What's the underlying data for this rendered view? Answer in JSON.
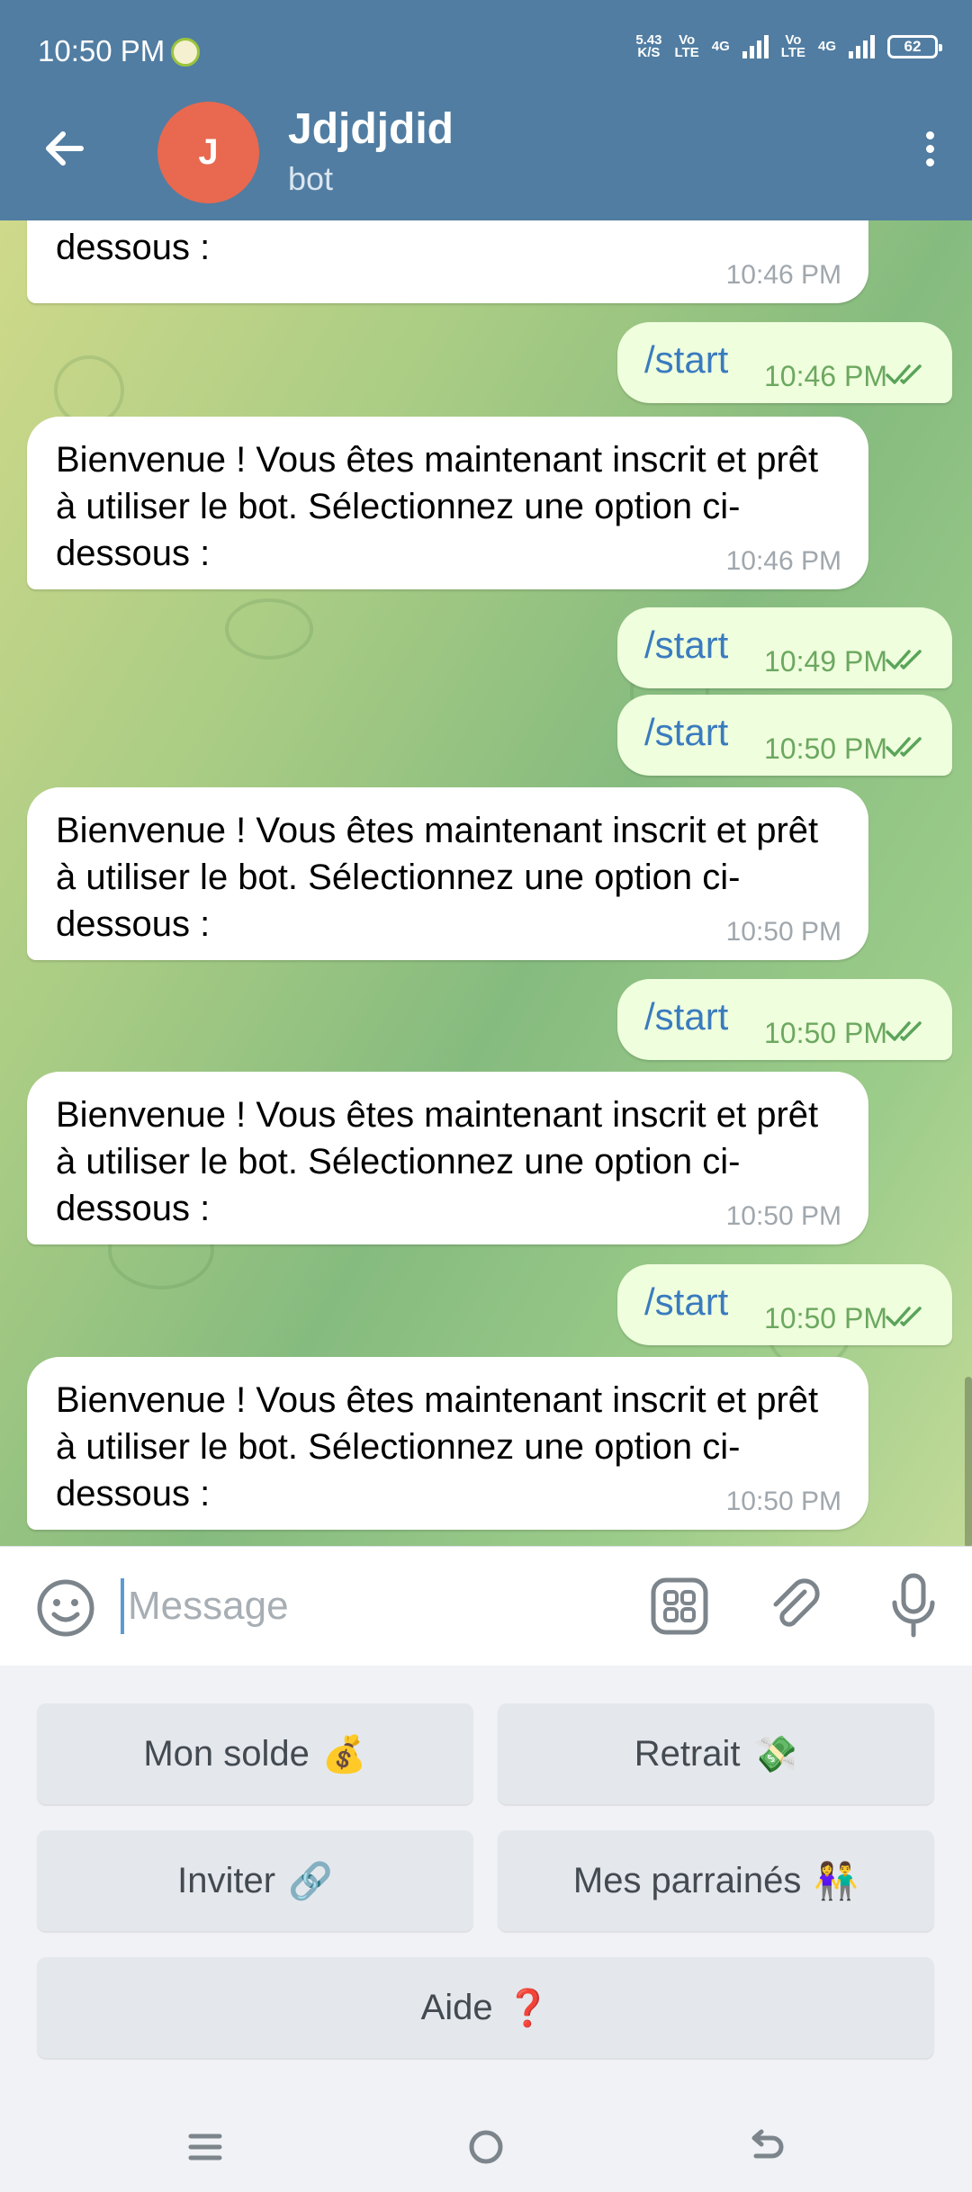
{
  "status_bar": {
    "time": "10:50 PM",
    "net_speed": "5.43",
    "net_unit": "K/S",
    "volte1_top": "Vo",
    "volte1_bottom": "LTE",
    "net1": "4G",
    "volte2_top": "Vo",
    "volte2_bottom": "LTE",
    "net2": "4G",
    "battery": "62"
  },
  "header": {
    "avatar_letter": "J",
    "avatar_color": "#e8694f",
    "title": "Jdjdjdid",
    "subtitle": "bot",
    "bar_color": "#517da2"
  },
  "messages": [
    {
      "dir": "in",
      "text": "prêt à utiliser le bot. Sélectionnez une option ci-dessous :",
      "time": "10:46 PM"
    },
    {
      "dir": "out",
      "text": "/start",
      "time": "10:46 PM"
    },
    {
      "dir": "in",
      "text": "Bienvenue ! Vous êtes maintenant inscrit et prêt à utiliser le bot. Sélectionnez une option ci-dessous :",
      "time": "10:46 PM"
    },
    {
      "dir": "out",
      "text": "/start",
      "time": "10:49 PM"
    },
    {
      "dir": "out",
      "text": "/start",
      "time": "10:50 PM"
    },
    {
      "dir": "in",
      "text": "Bienvenue ! Vous êtes maintenant inscrit et prêt à utiliser le bot. Sélectionnez une option ci-dessous :",
      "time": "10:50 PM"
    },
    {
      "dir": "out",
      "text": "/start",
      "time": "10:50 PM"
    },
    {
      "dir": "in",
      "text": "Bienvenue ! Vous êtes maintenant inscrit et prêt à utiliser le bot. Sélectionnez une option ci-dessous :",
      "time": "10:50 PM"
    },
    {
      "dir": "out",
      "text": "/start",
      "time": "10:50 PM"
    },
    {
      "dir": "in",
      "text": "Bienvenue ! Vous êtes maintenant inscrit et prêt à utiliser le bot. Sélectionnez une option ci-dessous :",
      "time": "10:50 PM"
    }
  ],
  "input": {
    "placeholder": "Message",
    "value": ""
  },
  "keyboard": {
    "buttons": [
      {
        "label": "Mon solde",
        "emoji": "💰"
      },
      {
        "label": "Retrait",
        "emoji": "💸"
      },
      {
        "label": "Inviter",
        "emoji": "🔗"
      },
      {
        "label": "Mes parrainés",
        "emoji": "👫"
      },
      {
        "label": "Aide",
        "emoji": "❓"
      }
    ]
  },
  "icons": {
    "back": "arrow-left-icon",
    "menu": "more-vertical-icon",
    "emoji": "smile-icon",
    "commands": "bot-commands-icon",
    "attach": "paperclip-icon",
    "mic": "microphone-icon",
    "read": "double-check-icon"
  }
}
